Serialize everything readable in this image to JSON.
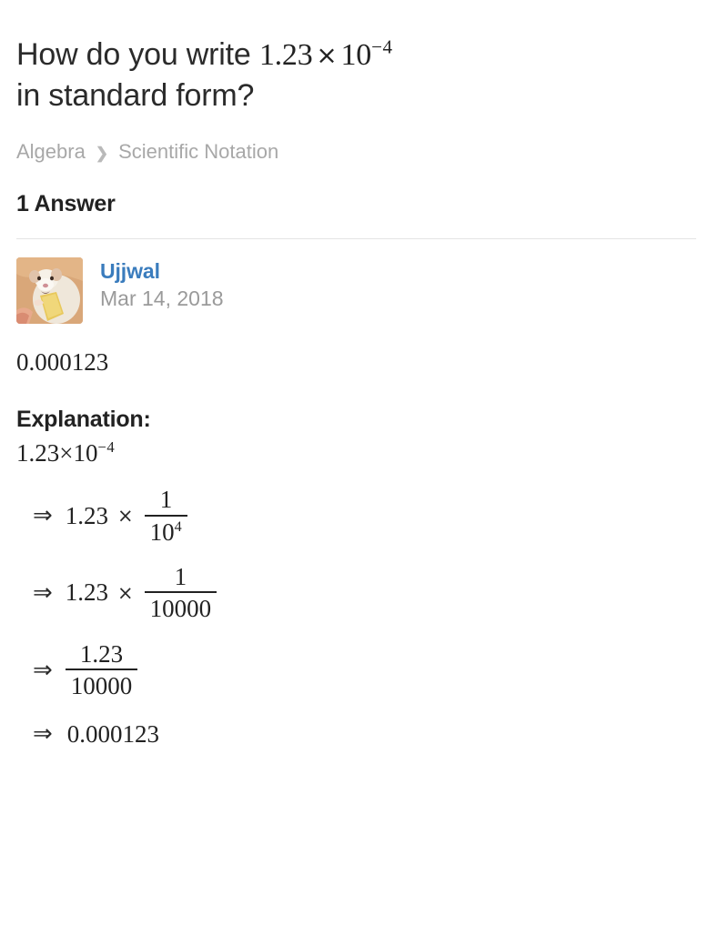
{
  "question": {
    "text_before_math": "How do you write ",
    "math_coefficient": "1.23",
    "math_times": "×",
    "math_base": "10",
    "math_exponent": "−4",
    "text_after_math": "in standard form?"
  },
  "breadcrumb": {
    "items": [
      "Algebra",
      "Scientific Notation"
    ],
    "separator": "❯"
  },
  "answers": {
    "heading": "1 Answer"
  },
  "author": {
    "name": "Ujjwal",
    "date": "Mar 14, 2018",
    "avatar_alt": "rat-photo-avatar",
    "avatar_colors": {
      "background": "#d9a779",
      "animal": "#f2ece2",
      "food": "#e8c85c",
      "hand": "#e8a98c"
    }
  },
  "answer": {
    "value": "0.000123",
    "explanation_heading": "Explanation:",
    "expression": {
      "coefficient": "1.23",
      "times": "×",
      "base": "10",
      "exponent": "−4"
    },
    "steps": [
      {
        "arrow": "⇒",
        "coefficient": "1.23",
        "times": "×",
        "numerator": "1",
        "denominator_base": "10",
        "denominator_exponent": "4"
      },
      {
        "arrow": "⇒",
        "coefficient": "1.23",
        "times": "×",
        "numerator": "1",
        "denominator": "10000"
      },
      {
        "arrow": "⇒",
        "numerator": "1.23",
        "denominator": "10000"
      },
      {
        "arrow": "⇒",
        "result": "0.000123"
      }
    ]
  },
  "colors": {
    "text": "#222222",
    "muted": "#a8a8a8",
    "link": "#3a7cbd",
    "divider": "#e4e4e4",
    "background": "#ffffff"
  }
}
